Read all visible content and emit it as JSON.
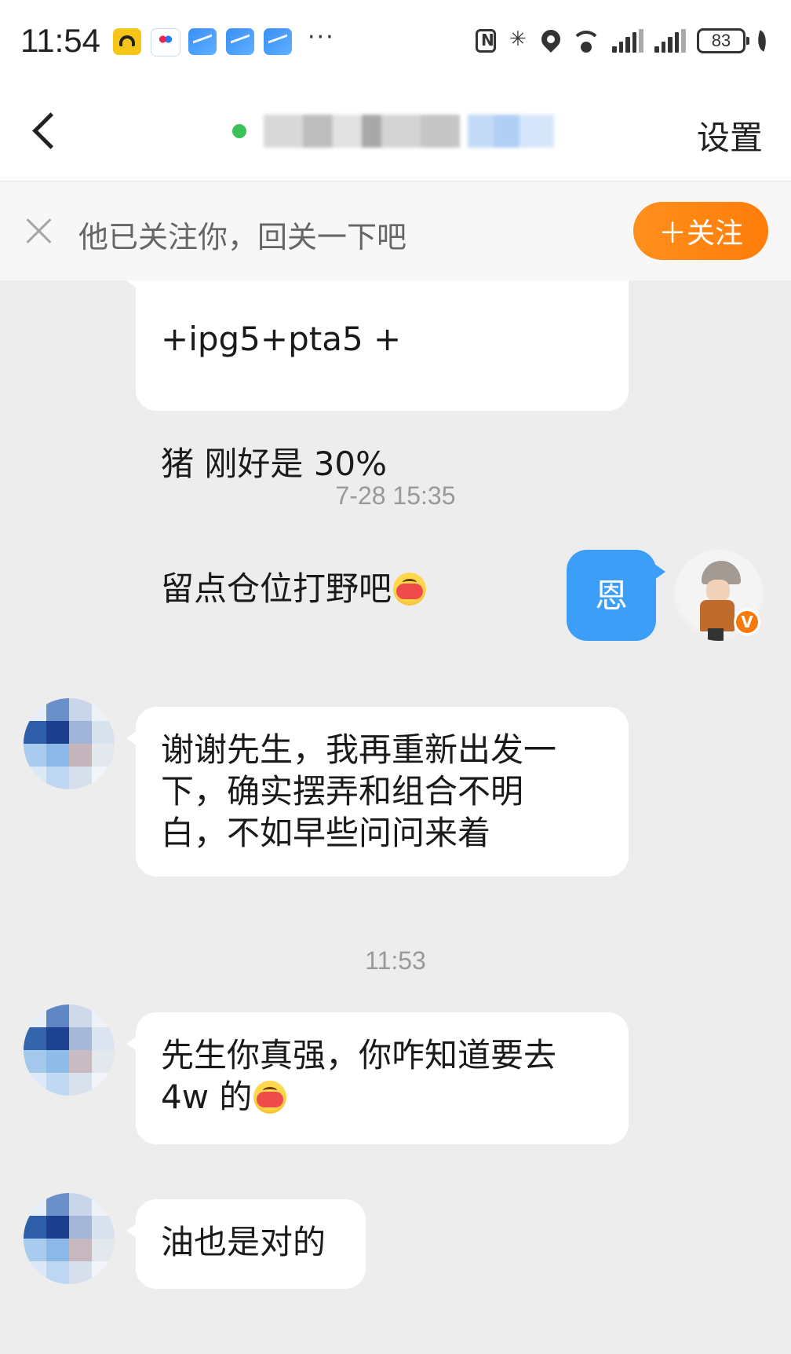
{
  "status_bar": {
    "time": "11:54",
    "dots": "···",
    "battery": "83"
  },
  "nav": {
    "settings_label": "设置"
  },
  "follow_banner": {
    "text": "他已关注你，回关一下吧",
    "button_label": "＋关注",
    "button_color": "#ff8a14"
  },
  "messages": [
    {
      "side": "left",
      "lines": [
        "+ipg5+pta5 +",
        "猪 刚好是 30%",
        "留点仓位打野吧"
      ],
      "emoji": "hugging-face-emoji"
    },
    {
      "type": "time",
      "text": "7-28 15:35"
    },
    {
      "side": "right",
      "text": "恩",
      "bubble_color": "#3d9ef7"
    },
    {
      "side": "left",
      "text": "谢谢先生，我再重新出发一\n下，确实摆弄和组合不明\n白，不如早些问问来着"
    },
    {
      "type": "time",
      "text": "11:53"
    },
    {
      "side": "left",
      "text": "先生你真强，你咋知道要去\n4w 的",
      "emoji": "hugging-face-emoji"
    },
    {
      "side": "left",
      "text": "油也是对的"
    }
  ],
  "verified_badge": "V"
}
